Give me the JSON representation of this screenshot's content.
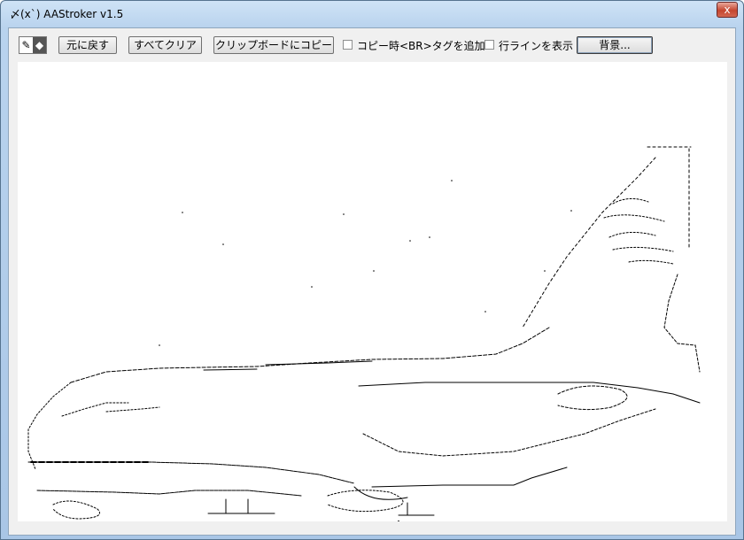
{
  "window": {
    "title": "〆(x`) AAStroker v1.5",
    "close_glyph": "x"
  },
  "toolbar": {
    "pen_icon": "pencil-icon",
    "eraser_icon": "eraser-icon",
    "undo_label": "元に戻す",
    "clear_label": "すべてクリア",
    "copy_label": "クリップボードにコピー",
    "br_tag_label": "コピー時<BR>タグを追加",
    "br_tag_checked": false,
    "line_numbers_label": "行ラインを表示",
    "line_numbers_checked": false,
    "background_label": "背景..."
  },
  "canvas": {
    "background": "#ffffff",
    "ink_color": "#000000",
    "content": "ascii-art-airplane-drawing"
  }
}
